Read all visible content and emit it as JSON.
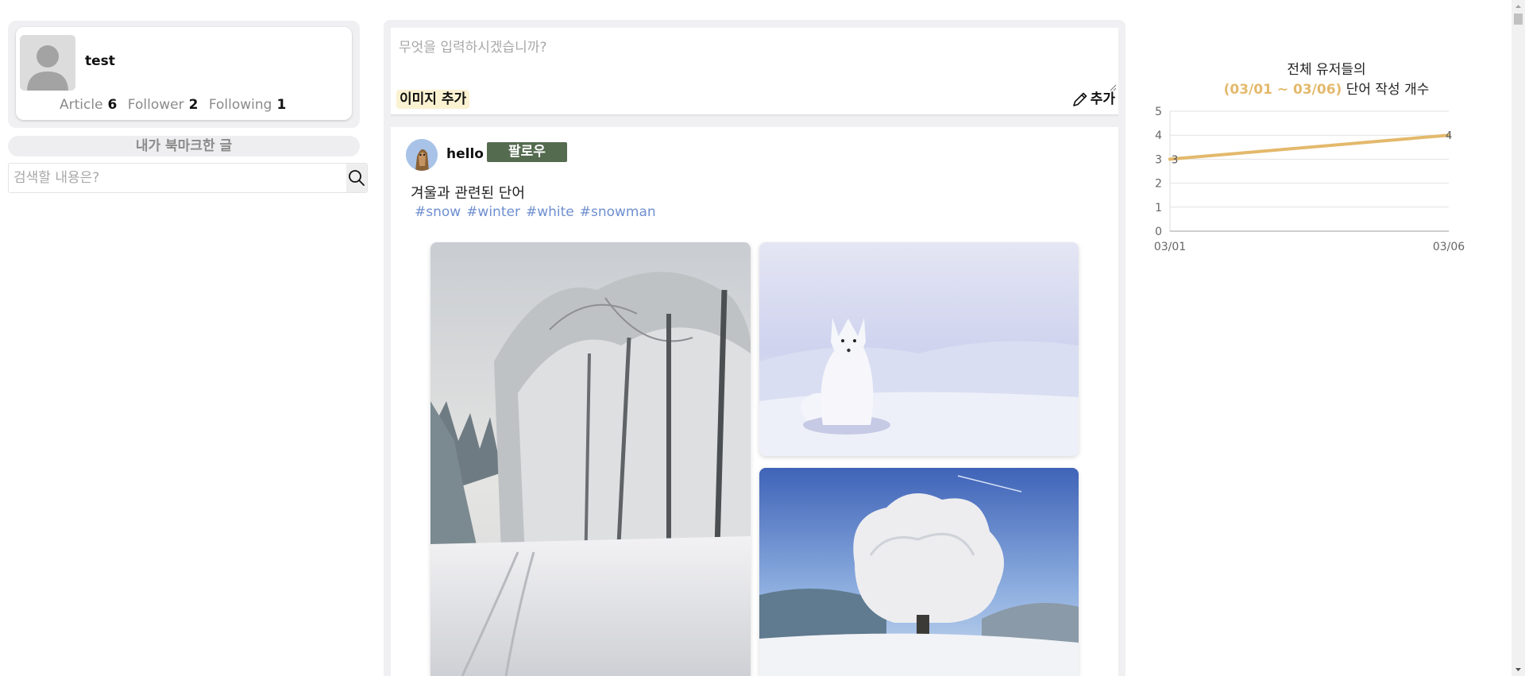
{
  "profile": {
    "username": "test",
    "article_label": "Article",
    "article_count": "6",
    "follower_label": "Follower",
    "follower_count": "2",
    "following_label": "Following",
    "following_count": "1"
  },
  "bookmarks": {
    "label": "내가 북마크한 글"
  },
  "search": {
    "placeholder": "검색할 내용은?"
  },
  "compose": {
    "placeholder": "무엇을 입력하시겠습니까?",
    "image_button": "이미지 추가",
    "submit_button": "추가"
  },
  "post": {
    "author": "hello",
    "follow_button": "팔로우",
    "text": "겨울과 관련된 단어",
    "tags": [
      "#snow",
      "#winter",
      "#white",
      "#snowman"
    ]
  },
  "chart_title": {
    "line1": "전체 유저들의",
    "range": "(03/01 ~ 03/06)",
    "line2_suffix": " 단어 작성 개수"
  },
  "chart_data": {
    "type": "line",
    "x": [
      "03/01",
      "03/06"
    ],
    "series": [
      {
        "values": [
          3,
          4
        ],
        "color": "#e3b96c"
      }
    ],
    "ylim": [
      0,
      5
    ],
    "yticks": [
      0,
      1,
      2,
      3,
      4,
      5
    ],
    "grid": true,
    "data_labels": [
      "3",
      "4"
    ]
  },
  "colors": {
    "accent": "#e3b96c",
    "follow_button": "#556b50",
    "tag": "#6f8fd0",
    "image_button_bg": "#fbf2d2"
  }
}
